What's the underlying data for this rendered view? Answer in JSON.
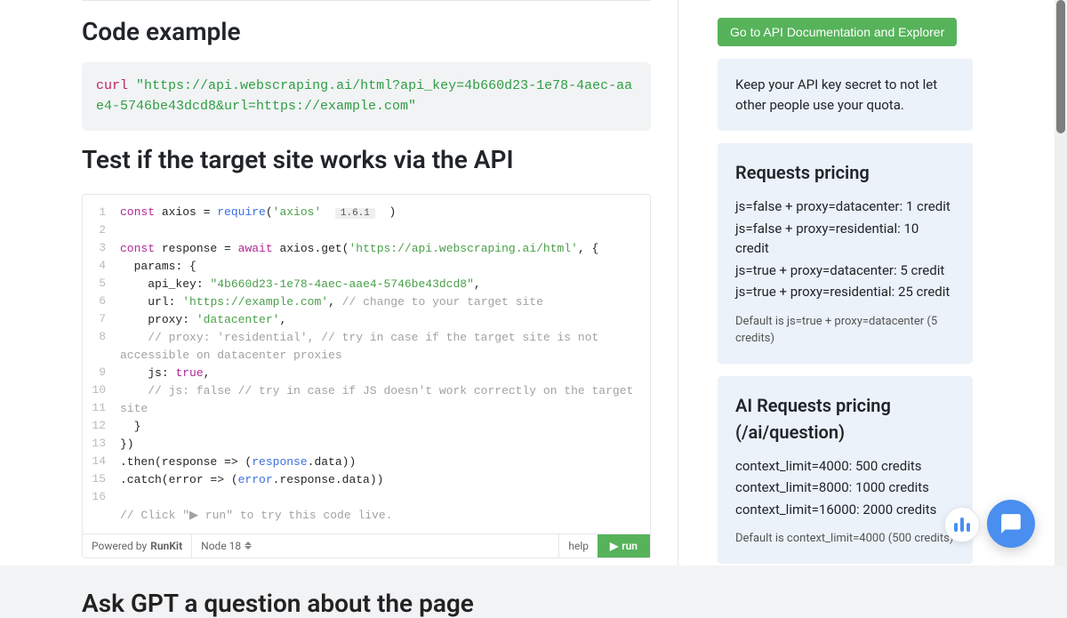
{
  "main": {
    "heading_code_example": "Code example",
    "curl_cmd": "curl",
    "curl_url": "\"https://api.webscraping.ai/html?api_key=4b660d23-1e78-4aec-aae4-5746be43dcd8&url=https://example.com\"",
    "heading_test": "Test if the target site works via the API",
    "heading_gpt": "Ask GPT a question about the page"
  },
  "editor": {
    "line1_kw": "const",
    "line1_a": " axios = ",
    "line1_fn": "require",
    "line1_b": "(",
    "line1_str": "'axios'",
    "line1_ver": "1.6.1",
    "line1_c": ")",
    "line3_kw": "const",
    "line3_a": " response = ",
    "line3_kw2": "await",
    "line3_b": " axios.get(",
    "line3_str": "'https://api.webscraping.ai/html'",
    "line3_c": ", {",
    "line4": "  params: {",
    "line5_a": "    api_key: ",
    "line5_str": "\"4b660d23-1e78-4aec-aae4-5746be43dcd8\"",
    "line5_b": ",",
    "line6_a": "    url: ",
    "line6_str": "'https://example.com'",
    "line6_b": ", ",
    "line6_cm": "// change to your target site",
    "line7_a": "    proxy: ",
    "line7_str": "'datacenter'",
    "line7_b": ",",
    "line8_a": "    ",
    "line8_cm": "// proxy: 'residential', // try in case if the target site is not accessible on datacenter proxies",
    "line9_a": "    js: ",
    "line9_bool": "true",
    "line9_b": ",",
    "line10_a": "    ",
    "line10_cm": "// js: false // try in case if JS doesn't work correctly on the target site",
    "line11": "  }",
    "line12": "})",
    "line13_a": ".then(response => (",
    "line13_fn": "response",
    "line13_b": ".data))",
    "line14_a": ".catch(error => (",
    "line14_fn": "error",
    "line14_b": ".response.data))",
    "line16_cm": "// Click \"▶ run\" to try this code live."
  },
  "gutter": [
    "1",
    "2",
    "3",
    "4",
    "5",
    "6",
    "7",
    "8",
    "9",
    "10",
    "11",
    "12",
    "13",
    "14",
    "15",
    "16"
  ],
  "footer": {
    "powered": "Powered by ",
    "runkit": "RunKit",
    "node": "Node 18",
    "help": "help",
    "run": "run"
  },
  "sidebar": {
    "cta": "Go to API Documentation and Explorer",
    "secret": "Keep your API key secret to not let other people use your quota.",
    "pricing_title": "Requests pricing",
    "pricing_lines": [
      "js=false + proxy=datacenter: 1 credit",
      "js=false + proxy=residential: 10 credit",
      "js=true + proxy=datacenter: 5 credit",
      "js=true + proxy=residential: 25 credit"
    ],
    "pricing_sub": "Default is js=true + proxy=datacenter (5 credits)",
    "ai_title": "AI Requests pricing (/ai/question)",
    "ai_lines": [
      "context_limit=4000: 500 credits",
      "context_limit=8000: 1000 credits",
      "context_limit=16000: 2000 credits"
    ],
    "ai_sub": "Default is context_limit=4000 (500 credits)"
  }
}
